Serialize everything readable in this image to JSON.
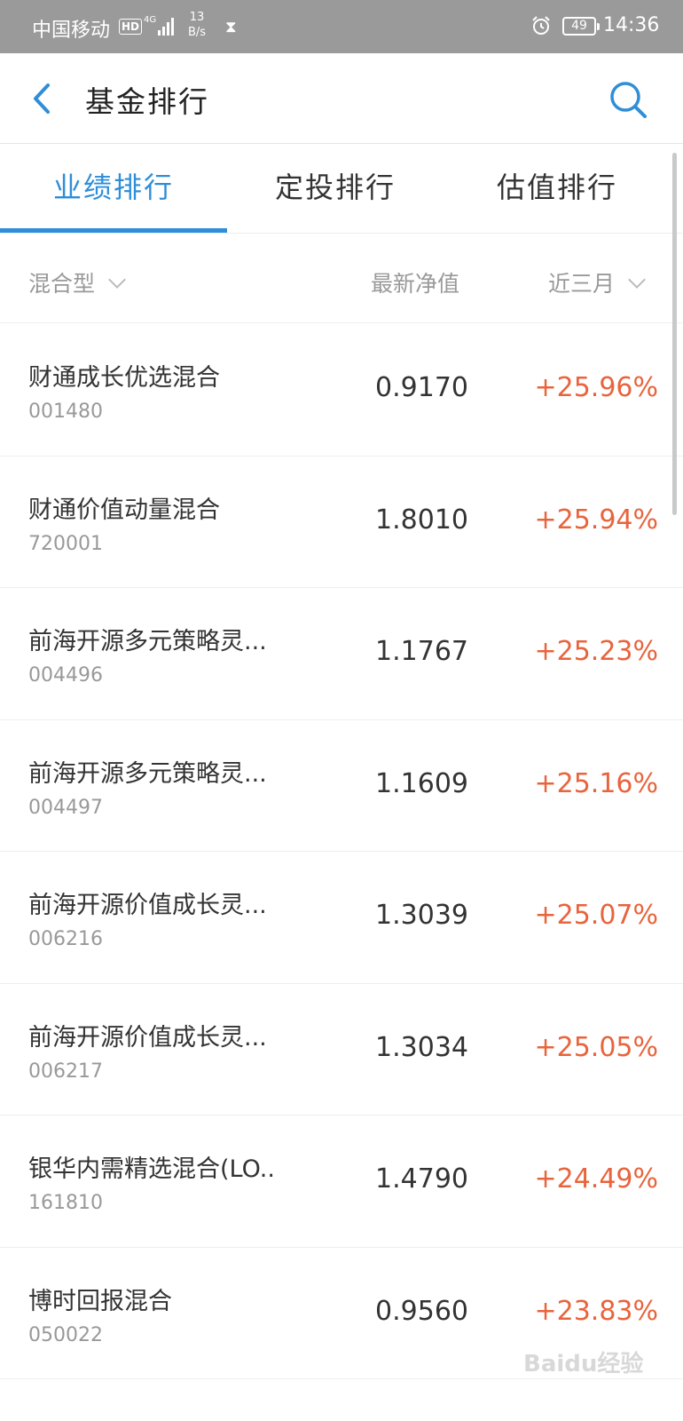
{
  "status_bar": {
    "carrier": "中国移动",
    "hd_badge": "HD",
    "network": "4G",
    "speed_value": "13",
    "speed_unit": "B/s",
    "battery": "49",
    "time": "14:36"
  },
  "header": {
    "title": "基金排行"
  },
  "tabs": [
    {
      "label": "业绩排行",
      "active": true
    },
    {
      "label": "定投排行",
      "active": false
    },
    {
      "label": "估值排行",
      "active": false
    }
  ],
  "columns": {
    "type_filter": "混合型",
    "nav_label": "最新净值",
    "period_filter": "近三月"
  },
  "funds": [
    {
      "name": "财通成长优选混合",
      "code": "001480",
      "nav": "0.9170",
      "change": "+25.96%"
    },
    {
      "name": "财通价值动量混合",
      "code": "720001",
      "nav": "1.8010",
      "change": "+25.94%"
    },
    {
      "name": "前海开源多元策略灵...",
      "code": "004496",
      "nav": "1.1767",
      "change": "+25.23%"
    },
    {
      "name": "前海开源多元策略灵...",
      "code": "004497",
      "nav": "1.1609",
      "change": "+25.16%"
    },
    {
      "name": "前海开源价值成长灵...",
      "code": "006216",
      "nav": "1.3039",
      "change": "+25.07%"
    },
    {
      "name": "前海开源价值成长灵...",
      "code": "006217",
      "nav": "1.3034",
      "change": "+25.05%"
    },
    {
      "name": "银华内需精选混合(LO..",
      "code": "161810",
      "nav": "1.4790",
      "change": "+24.49%"
    },
    {
      "name": "博时回报混合",
      "code": "050022",
      "nav": "0.9560",
      "change": "+23.83%"
    }
  ],
  "watermark": "Baidu经验",
  "colors": {
    "accent": "#2f8ed8",
    "positive": "#e8643c",
    "status_bar": "#9a9a9a"
  }
}
